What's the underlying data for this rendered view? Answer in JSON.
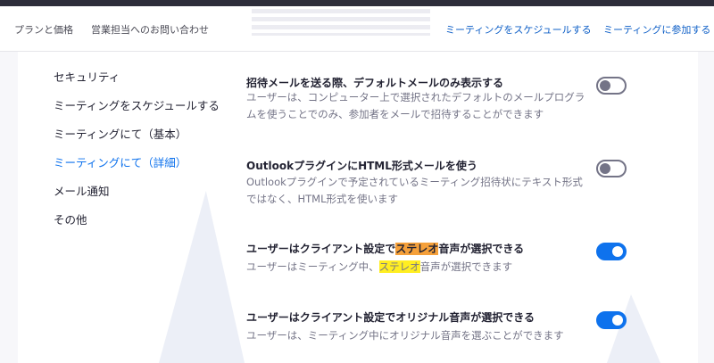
{
  "header": {
    "links_left": [
      "プランと価格",
      "営業担当へのお問い合わせ"
    ],
    "links_right": [
      "ミーティングをスケジュールする",
      "ミーティングに参加する"
    ]
  },
  "sidebar": {
    "items": [
      {
        "label": "セキュリティ",
        "active": false
      },
      {
        "label": "ミーティングをスケジュールする",
        "active": false
      },
      {
        "label": "ミーティングにて（基本）",
        "active": false
      },
      {
        "label": "ミーティングにて（詳細）",
        "active": true
      },
      {
        "label": "メール通知",
        "active": false
      },
      {
        "label": "その他",
        "active": false
      }
    ]
  },
  "settings": [
    {
      "title": "招待メールを送る際、デフォルトメールのみ表示する",
      "desc": "ユーザーは、コンピューター上で選択されたデフォルトのメールプログラムを使うことでのみ、参加者をメールで招待することができます",
      "enabled": false
    },
    {
      "title": "OutlookプラグインにHTML形式メールを使う",
      "desc": "Outlookプラグインで予定されているミーティング招待状にテキスト形式ではなく、HTML形式を使います",
      "enabled": false
    },
    {
      "title_pre": "ユーザーはクライアント設定で",
      "title_hl": "ステレオ",
      "title_post": "音声が選択できる",
      "desc_pre": "ユーザーはミーティング中、",
      "desc_hl": "ステレオ",
      "desc_post": "音声が選択できます",
      "enabled": true
    },
    {
      "title": "ユーザーはクライアント設定でオリジナル音声が選択できる",
      "desc": "ユーザーは、ミーティング中にオリジナル音声を選ぶことができます",
      "enabled": true
    }
  ],
  "colors": {
    "accent": "#0e72ed",
    "toggle_off": "#747487",
    "highlight_orange": "#f5a03a",
    "highlight_yellow": "#ffee22"
  }
}
